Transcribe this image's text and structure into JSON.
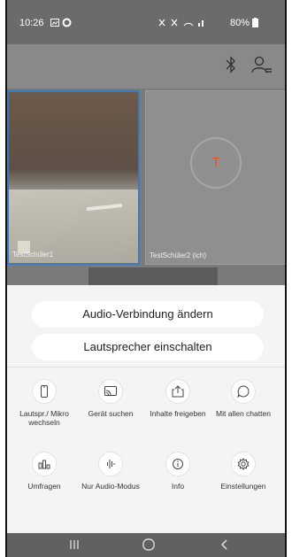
{
  "status_bar": {
    "time": "10:26",
    "right": "80%"
  },
  "video": {
    "tile1_name": "TestSchüler1",
    "tile2_name": "TestSchüler2 (ich)",
    "tile2_avatar": "T"
  },
  "sheet": {
    "btn_audio": "Audio-Verbindung ändern",
    "btn_speaker": "Lautsprecher einschalten",
    "items": [
      {
        "label": "Lautspr./ Mikro wechseln",
        "icon": "phone-speaker-icon"
      },
      {
        "label": "Gerät suchen",
        "icon": "cast-icon"
      },
      {
        "label": "Inhalte freigeben",
        "icon": "share-icon"
      },
      {
        "label": "Mit allen chatten",
        "icon": "chat-icon"
      },
      {
        "label": "Umfragen",
        "icon": "poll-icon"
      },
      {
        "label": "Nur Audio-Modus",
        "icon": "audio-wave-icon"
      },
      {
        "label": "Info",
        "icon": "info-icon"
      },
      {
        "label": "Einstellungen",
        "icon": "gear-icon"
      }
    ]
  },
  "colors": {
    "accent_border": "#3d7bbd",
    "avatar_letter": "#d9572f"
  }
}
